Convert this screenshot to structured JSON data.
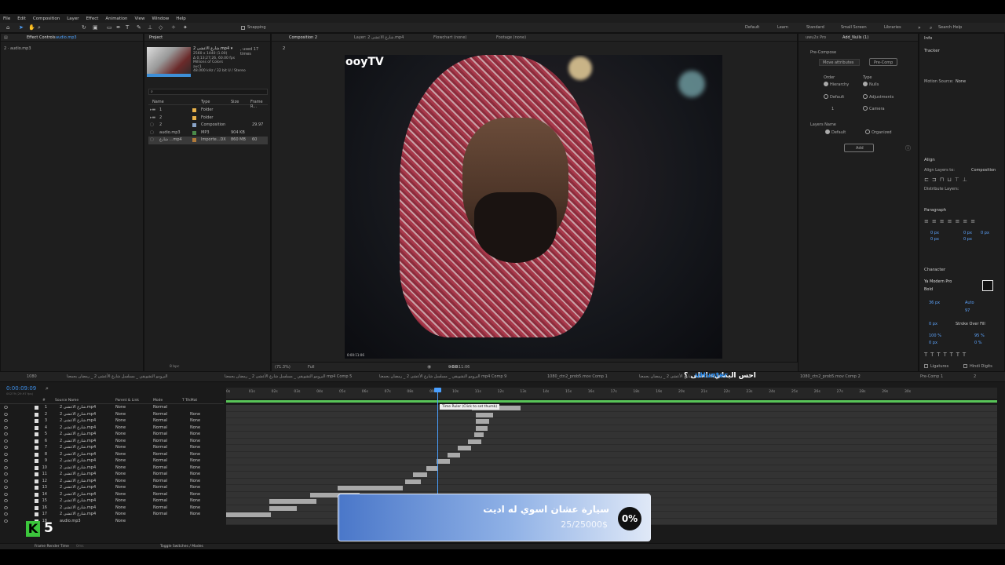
{
  "menu": [
    "File",
    "Edit",
    "Composition",
    "Layer",
    "Effect",
    "Animation",
    "View",
    "Window",
    "Help"
  ],
  "toolbar": {
    "snapping": "Snapping",
    "workspaces": [
      "Default",
      "Learn",
      "Standard",
      "Small Screen",
      "Libraries"
    ],
    "search": "Search Help"
  },
  "effect_controls": {
    "tab": "Effect Controls",
    "file": "audio.mp3",
    "source": "2 · audio.mp3"
  },
  "project": {
    "tab": "Project",
    "clip_name": "شارع الاعشى 2.mp4 ▾",
    "clip_used": ", used 17 times",
    "clip_info": [
      "2560 x 1440 (1.00)",
      "Δ 0;13;27;26, 60.00 fps",
      "Millions of Colors",
      "avc1",
      "48.000 kHz / 32 bit U / Stereo"
    ],
    "columns": [
      "Name",
      "Type",
      "Size",
      "Frame R..."
    ],
    "items": [
      {
        "name": "1",
        "type": "Folder",
        "size": "",
        "fr": ""
      },
      {
        "name": "2",
        "type": "Folder",
        "size": "",
        "fr": ""
      },
      {
        "name": "2",
        "type": "Composition",
        "size": "",
        "fr": "29.97"
      },
      {
        "name": "audio.mp3",
        "type": "MP3",
        "size": "904 KB",
        "fr": ""
      },
      {
        "name": "شارع ...mp4",
        "type": "Importe...DX",
        "size": "860 MB",
        "fr": "60"
      }
    ],
    "bpc": "8 bpc"
  },
  "comp_viewer": {
    "tab": "Composition 2",
    "layer_tab": "Layer: شارع الاعشى 2.mp4",
    "flowchart": "Flowchart (none)",
    "footage": "Footage (none)",
    "crumb": "2",
    "watermark": "ooyTV",
    "zoom": "(71.3%)",
    "quality": "Full",
    "timecode": "0:00:11:06",
    "frame_label": "0:00:11:06",
    "exposure": "+0.0"
  },
  "right_panels": {
    "tabs": [
      "uwu2x Pro",
      "Add_Nulls (1)"
    ],
    "precompose": "Pre-Compose",
    "move_attributes": "Move attributes",
    "precomp_btn": "Pre-Comp",
    "order_label": "Order",
    "order_opts": [
      "Hierarchy",
      "Default"
    ],
    "type_label": "Type",
    "type_opts": [
      "Nulls",
      "Adjustments",
      "Camera"
    ],
    "layers_name": "Layers Name",
    "name_opts": [
      "Default",
      "Organized"
    ],
    "add_btn": "Add",
    "spinner": "1",
    "info": "Info",
    "tracker": "Tracker",
    "motion_source": "Motion Source:",
    "motion_value": "None",
    "align": "Align",
    "align_to": "Align Layers to:",
    "align_value": "Composition",
    "distribute": "Distribute Layers:",
    "paragraph": "Paragraph",
    "para_values": [
      "0 px",
      "0 px",
      "0 px",
      "0 px",
      "0 px"
    ],
    "character": "Character",
    "font": "Ya Modern Pro",
    "style": "Bold",
    "font_size": "36 px",
    "leading": "Auto",
    "tracking": "97",
    "stroke": "0 px",
    "stroke_mode": "Stroke Over Fill",
    "scale_v": "100 %",
    "scale_h": "95 %",
    "baseline": "0 px",
    "tsume": "0 %",
    "ligatures": "Ligatures",
    "hindi": "Hindi Digits"
  },
  "timeline": {
    "tabs": [
      "1080",
      "البرومو التشويقي _ مسلسل شارع الأعشى 2 _ رمضان يجمعنا",
      "البرومو التشويقي _ مسلسل شارع الأعشى 2 _ رمضان يجمعنا mp4 Comp 5",
      "البرومو التشويقي _ مسلسل شارع الأعشى 2 _ رمضان يجمعنا mp4 Comp 9",
      "1080_ctn2_prob5.mov Comp 1",
      "شارع الأعشى 2 _ رمضان يجمعنا mp4 Comp 3",
      "1080_ctn2_prob5.mov Comp 2",
      "Pre-Comp 1",
      "2"
    ],
    "timecode": "0:00:09:09",
    "fps": "00279 (29.97 fps)",
    "columns": [
      "#",
      "Source Name",
      "Parent & Link",
      "Mode",
      "T TrkMat"
    ],
    "layer_name": "شارع الاعشى 2.mp4",
    "audio_layer": "audio.mp3",
    "parent": "None",
    "mode": "Normal",
    "ruler": [
      "0s",
      "01s",
      "02s",
      "03s",
      "04s",
      "05s",
      "06s",
      "07s",
      "08s",
      "09s",
      "10s",
      "11s",
      "12s",
      "13s",
      "14s",
      "15s",
      "16s",
      "17s",
      "18s",
      "19s",
      "20s",
      "21s",
      "22s",
      "23s",
      "24s",
      "25s",
      "26s",
      "27s",
      "28s",
      "29s",
      "30s"
    ],
    "tooltip": "Time Ruler (Click to set thumb)",
    "frame_render": "Frame Render Time",
    "frame_render_value": "0ms",
    "toggle": "Toggle Switches / Modes",
    "overlay_text": "احس البطيء احلى ؟",
    "overlay_logo": "uHunter"
  },
  "badge": {
    "title": "سيارة عشان اسوي له اديت",
    "progress": "25/25000$",
    "percent": "0%",
    "progress_fraction": 0.001
  },
  "k_counter": "5",
  "colors": {
    "accent": "#2d8ceb",
    "green": "#3cc63c",
    "work_area": "#58c458",
    "playhead": "#4aa0ff",
    "badge_start": "#4a77c9",
    "badge_end": "#dfe8f7"
  }
}
